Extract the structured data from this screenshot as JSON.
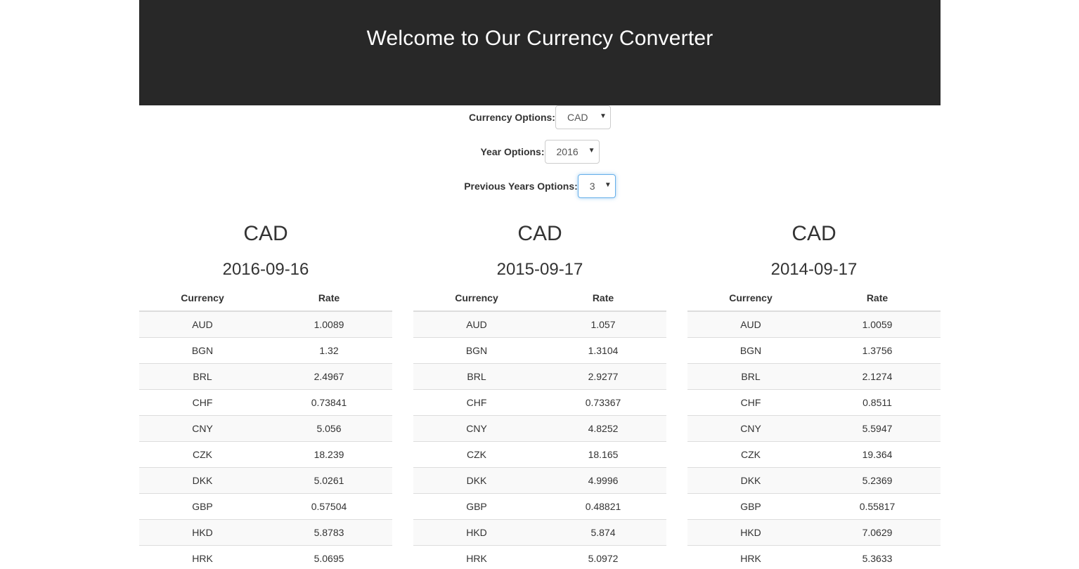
{
  "header": {
    "title": "Welcome to Our Currency Converter"
  },
  "options": {
    "currency_label": "Currency Options:",
    "currency_value": "CAD",
    "year_label": "Year Options:",
    "year_value": "2016",
    "previous_label": "Previous Years Options:",
    "previous_value": "3"
  },
  "table_headers": {
    "currency": "Currency",
    "rate": "Rate"
  },
  "columns": [
    {
      "currency": "CAD",
      "date": "2016-09-16",
      "rows": [
        {
          "code": "AUD",
          "rate": "1.0089"
        },
        {
          "code": "BGN",
          "rate": "1.32"
        },
        {
          "code": "BRL",
          "rate": "2.4967"
        },
        {
          "code": "CHF",
          "rate": "0.73841"
        },
        {
          "code": "CNY",
          "rate": "5.056"
        },
        {
          "code": "CZK",
          "rate": "18.239"
        },
        {
          "code": "DKK",
          "rate": "5.0261"
        },
        {
          "code": "GBP",
          "rate": "0.57504"
        },
        {
          "code": "HKD",
          "rate": "5.8783"
        },
        {
          "code": "HRK",
          "rate": "5.0695"
        }
      ]
    },
    {
      "currency": "CAD",
      "date": "2015-09-17",
      "rows": [
        {
          "code": "AUD",
          "rate": "1.057"
        },
        {
          "code": "BGN",
          "rate": "1.3104"
        },
        {
          "code": "BRL",
          "rate": "2.9277"
        },
        {
          "code": "CHF",
          "rate": "0.73367"
        },
        {
          "code": "CNY",
          "rate": "4.8252"
        },
        {
          "code": "CZK",
          "rate": "18.165"
        },
        {
          "code": "DKK",
          "rate": "4.9996"
        },
        {
          "code": "GBP",
          "rate": "0.48821"
        },
        {
          "code": "HKD",
          "rate": "5.874"
        },
        {
          "code": "HRK",
          "rate": "5.0972"
        }
      ]
    },
    {
      "currency": "CAD",
      "date": "2014-09-17",
      "rows": [
        {
          "code": "AUD",
          "rate": "1.0059"
        },
        {
          "code": "BGN",
          "rate": "1.3756"
        },
        {
          "code": "BRL",
          "rate": "2.1274"
        },
        {
          "code": "CHF",
          "rate": "0.8511"
        },
        {
          "code": "CNY",
          "rate": "5.5947"
        },
        {
          "code": "CZK",
          "rate": "19.364"
        },
        {
          "code": "DKK",
          "rate": "5.2369"
        },
        {
          "code": "GBP",
          "rate": "0.55817"
        },
        {
          "code": "HKD",
          "rate": "7.0629"
        },
        {
          "code": "HRK",
          "rate": "5.3633"
        }
      ]
    }
  ],
  "icons": {
    "select_arrow": "caret-down-icon"
  },
  "colors": {
    "header_bg": "#282828",
    "focus_border": "#66afe9",
    "stripe": "#f9f9f9"
  }
}
